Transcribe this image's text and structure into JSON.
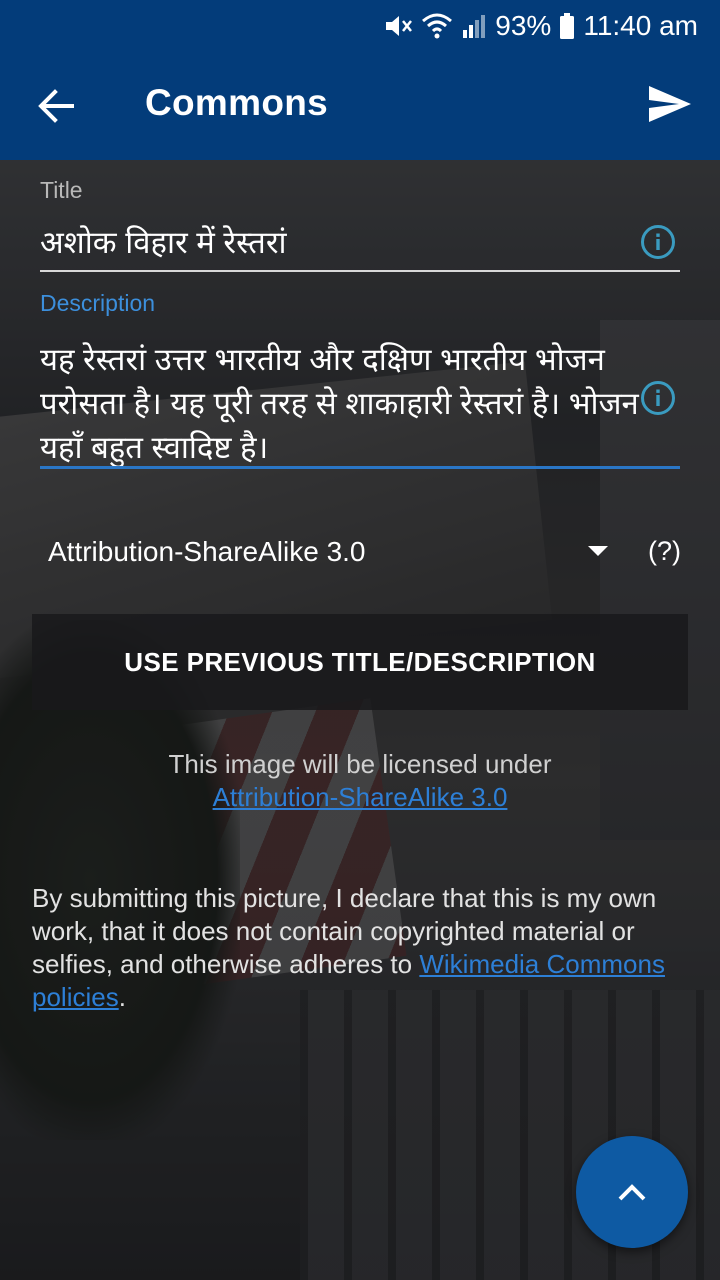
{
  "status_bar": {
    "battery": "93%",
    "time": "11:40 am",
    "icons": [
      "mute-icon",
      "wifi-icon",
      "signal-icon",
      "battery-icon"
    ]
  },
  "toolbar": {
    "title": "Commons",
    "back_icon": "back-arrow-icon",
    "send_icon": "send-icon"
  },
  "form": {
    "title_label": "Title",
    "title_value": "अशोक विहार में रेस्तरां",
    "description_label": "Description",
    "description_value": "यह रेस्तरां उत्तर भारतीय और दक्षिण भारतीय भोजन परोसता है। यह पूरी तरह से शाकाहारी रेस्तरां है। भोजन यहाँ बहुत स्वादिष्ट है।",
    "license_selected": "Attribution-ShareAlike 3.0",
    "license_help": "(?)",
    "use_previous_button": "USE PREVIOUS TITLE/DESCRIPTION"
  },
  "license_note": {
    "text": "This image will be licensed under",
    "link": "Attribution-ShareAlike 3.0"
  },
  "declaration": {
    "text": "By submitting this picture, I declare that this is my own work, that it does not contain copyrighted material or selfies, and otherwise adheres to",
    "link": "Wikimedia Commons policies",
    "suffix": "."
  },
  "colors": {
    "primary": "#033c7a",
    "accent": "#2a76c6",
    "link": "#2d7fd6",
    "info_icon": "#3a9bc0",
    "fab": "#0e5aa3"
  }
}
